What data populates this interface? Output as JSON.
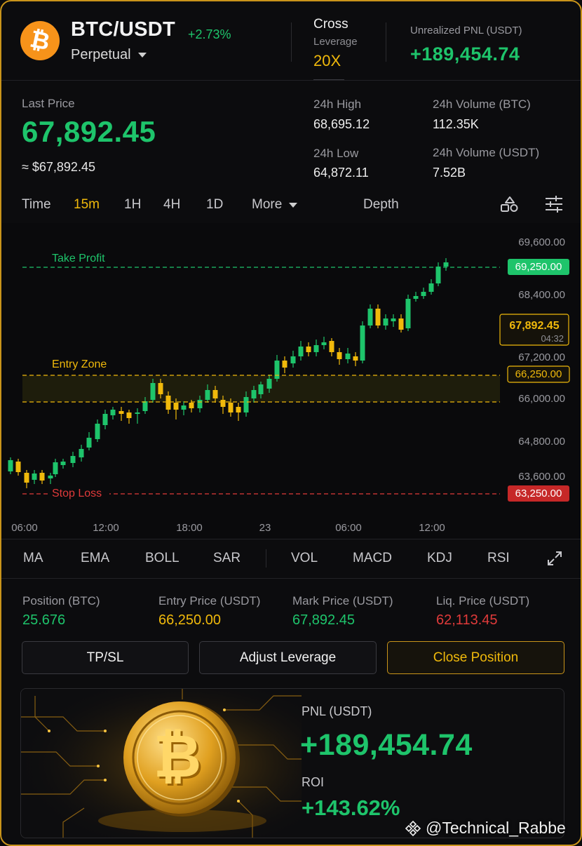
{
  "header": {
    "coin_symbol": "₿",
    "pair": "BTC/USDT",
    "change": "+2.73%",
    "contract_type": "Perpetual",
    "margin_mode": "Cross",
    "leverage_label": "Leverage",
    "leverage_value": "20X",
    "unrealized_pnl_label": "Unrealized PNL (USDT)",
    "unrealized_pnl_value": "+189,454.74"
  },
  "price": {
    "last_price_label": "Last Price",
    "last_price": "67,892.45",
    "usd_equiv": "≈ $67,892.45",
    "high_label": "24h High",
    "high": "68,695.12",
    "low_label": "24h Low",
    "low": "64,872.11",
    "vol_btc_label": "24h Volume (BTC)",
    "vol_btc": "112.35K",
    "vol_usdt_label": "24h Volume (USDT)",
    "vol_usdt": "7.52B"
  },
  "tabs": {
    "time": "Time",
    "m15": "15m",
    "h1": "1H",
    "h4": "4H",
    "d1": "1D",
    "more": "More",
    "depth": "Depth"
  },
  "chart_data": {
    "type": "candlestick",
    "y_ticks": [
      "69,600.00",
      "68,400.00",
      "67,200.00",
      "66,000.00",
      "64,800.00",
      "63,600.00"
    ],
    "x_ticks": [
      "06:00",
      "12:00",
      "18:00",
      "23",
      "06:00",
      "12:00"
    ],
    "take_profit_label": "Take Profit",
    "take_profit": "69,250.00",
    "entry_zone_label": "Entry Zone",
    "entry_price_tag": "66,250.00",
    "stop_loss_label": "Stop Loss",
    "stop_loss": "63,250.00",
    "current_price": "67,892.45",
    "countdown": "04:32",
    "colors": {
      "up": "#1ec46b",
      "down": "#f0b90b",
      "take_profit": "#1ec46b",
      "entry": "#f0b90b",
      "stop": "#e03a3a"
    }
  },
  "indicators": [
    "MA",
    "EMA",
    "BOLL",
    "SAR",
    "VOL",
    "MACD",
    "KDJ",
    "RSI"
  ],
  "position": {
    "size_label": "Position (BTC)",
    "size": "25.676",
    "entry_label": "Entry Price (USDT)",
    "entry": "66,250.00",
    "mark_label": "Mark Price (USDT)",
    "mark": "67,892.45",
    "liq_label": "Liq. Price (USDT)",
    "liq": "62,113.45"
  },
  "buttons": {
    "tpsl": "TP/SL",
    "adjust": "Adjust Leverage",
    "close": "Close Position"
  },
  "pnl_card": {
    "coin_symbol": "₿",
    "pnl_label": "PNL (USDT)",
    "pnl": "+189,454.74",
    "roi_label": "ROI",
    "roi": "+143.62%"
  },
  "watermark": "@Technical_Rabbe"
}
